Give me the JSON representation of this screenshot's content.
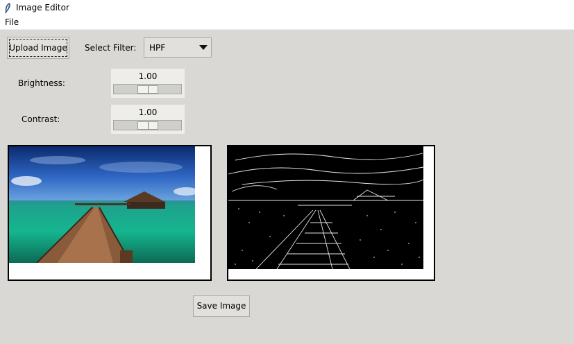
{
  "window": {
    "title": "Image Editor",
    "icon": "feather-icon"
  },
  "menubar": {
    "file_label": "File"
  },
  "toolbar": {
    "upload_label": "Upload Image",
    "filter_label": "Select Filter:",
    "filter_value": "HPF"
  },
  "brightness": {
    "label": "Brightness:",
    "value": "1.00",
    "level": 0.5
  },
  "contrast": {
    "label": "Contrast:",
    "value": "1.00",
    "level": 0.5
  },
  "footer": {
    "save_label": "Save Image"
  },
  "colors": {
    "background": "#d9d8d4",
    "frame": "#000000"
  }
}
